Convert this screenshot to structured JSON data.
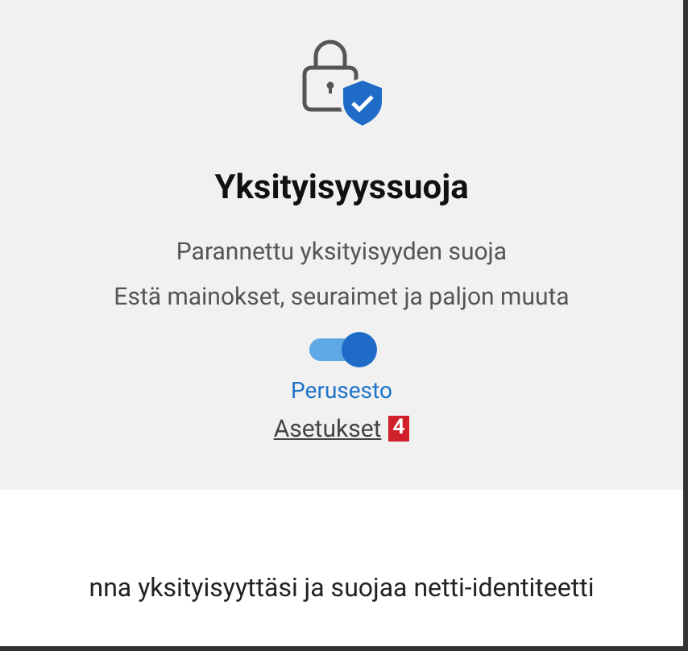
{
  "title": "Yksityisyyssuoja",
  "description": [
    "Parannettu yksityisyyden suoja",
    "Estä mainokset, seuraimet ja paljon muuta"
  ],
  "toggle": {
    "on": true,
    "label": "Perusesto"
  },
  "settings_link": "Asetukset",
  "callout_badge": "4",
  "tagline": "nna yksityisyyttäsi ja suojaa netti-identiteetti"
}
